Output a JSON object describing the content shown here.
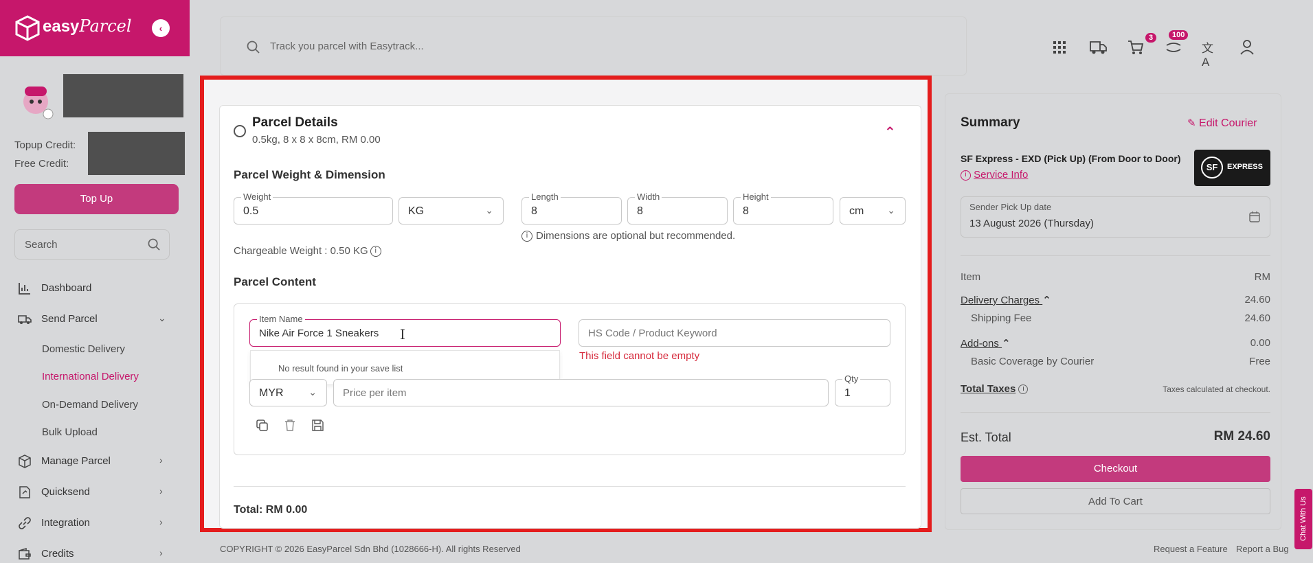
{
  "brand": {
    "name": "easy",
    "name_script": "Parcel"
  },
  "sidebar": {
    "topup_credit_label": "Topup Credit:",
    "free_credit_label": "Free Credit:",
    "topup_button": "Top Up",
    "search_placeholder": "Search",
    "nav": [
      {
        "label": "Dashboard"
      },
      {
        "label": "Send Parcel"
      },
      {
        "label": "Manage Parcel"
      },
      {
        "label": "Quicksend"
      },
      {
        "label": "Integration"
      },
      {
        "label": "Credits"
      }
    ],
    "sub_nav": [
      {
        "label": "Domestic Delivery"
      },
      {
        "label": "International Delivery"
      },
      {
        "label": "On-Demand Delivery"
      },
      {
        "label": "Bulk Upload"
      }
    ]
  },
  "header": {
    "search_placeholder": "Track you parcel with Easytrack...",
    "cart_count": "3",
    "notif_count": "100"
  },
  "parcel": {
    "title": "Parcel Details",
    "subtitle": "0.5kg, 8 x 8 x 8cm, RM 0.00",
    "weight_section": "Parcel Weight & Dimension",
    "weight_label": "Weight",
    "weight_value": "0.5",
    "weight_unit": "KG",
    "length_label": "Length",
    "length_value": "8",
    "width_label": "Width",
    "width_value": "8",
    "height_label": "Height",
    "height_value": "8",
    "dim_unit": "cm",
    "dim_hint": "Dimensions are optional but recommended.",
    "chargeable": "Chargeable Weight : 0.50 KG",
    "content_section": "Parcel Content",
    "item_name_label": "Item Name",
    "item_name_value": "Nike Air Force 1 Sneakers",
    "hs_placeholder": "HS Code / Product Keyword",
    "hs_error": "This field cannot be empty",
    "dropdown_empty": "No result found in your save list",
    "currency": "MYR",
    "price_placeholder": "Price per item",
    "qty_label": "Qty",
    "qty_value": "1",
    "total": "Total: RM 0.00"
  },
  "summary": {
    "title": "Summary",
    "edit_courier": "Edit Courier",
    "courier_name": "SF Express - EXD (Pick Up) (From Door to Door)",
    "service_info": "Service Info",
    "courier_logo_text": "EXPRESS",
    "pickup_label": "Sender Pick Up date",
    "pickup_value": "13 August 2026 (Thursday)",
    "item_col": "Item",
    "rm_col": "RM",
    "delivery_charges": "Delivery Charges",
    "delivery_charges_value": "24.60",
    "shipping_fee": "Shipping Fee",
    "shipping_fee_value": "24.60",
    "addons": "Add-ons",
    "addons_value": "0.00",
    "basic_coverage": "Basic Coverage by Courier",
    "basic_coverage_value": "Free",
    "total_taxes": "Total Taxes",
    "taxes_note": "Taxes calculated at checkout.",
    "est_total_label": "Est. Total",
    "est_total_value": "RM 24.60",
    "checkout": "Checkout",
    "add_to_cart": "Add To Cart"
  },
  "footer": {
    "copyright": "COPYRIGHT © 2026 EasyParcel Sdn Bhd (1028666-H). All rights Reserved",
    "request_feature": "Request a Feature",
    "report_bug": "Report a Bug"
  },
  "chat": "Chat With Us",
  "colors": {
    "brand": "#c6176b",
    "highlight": "#e41d1d",
    "error": "#d62a3c"
  }
}
